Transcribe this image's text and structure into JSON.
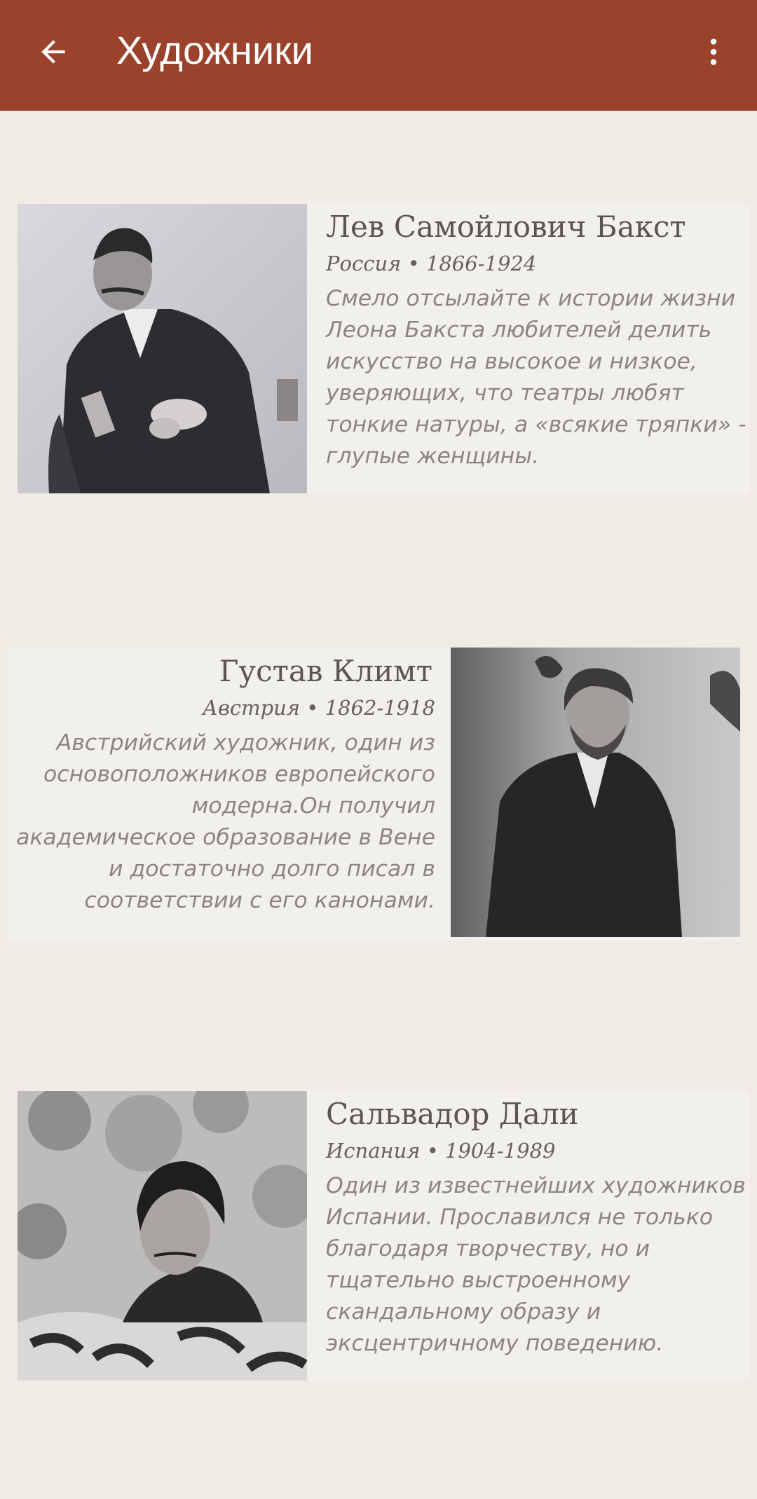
{
  "appbar": {
    "title": "Художники",
    "back_icon": "arrow-left-icon",
    "menu_icon": "more-vert-icon",
    "color": "#9b422c"
  },
  "artists": [
    {
      "name": "Лев Самойлович Бакст",
      "country": "Россия",
      "separator": "•",
      "years": "1866-1924",
      "description": "Смело отсылайте к истории жизни Леона Бакста любителей делить искусство на высокое и низкое, уверяющих, что театры любят тонкие натуры, а «всякие тряпки» - глупые женщины."
    },
    {
      "name": "Густав Климт",
      "country": "Австрия",
      "separator": "•",
      "years": "1862-1918",
      "description": "Австрийский художник, один из основоположников европейского модерна.Он получил академическое образование в Вене и достаточно долго писал в соответствии с его канонами."
    },
    {
      "name": "Сальвадор Дали",
      "country": "Испания",
      "separator": "•",
      "years": "1904-1989",
      "description": "Один из известнейших художников Испании. Прославился не только благодаря творчеству, но и тщательно выстроенному скандальному образу и эксцентричному поведению."
    }
  ]
}
